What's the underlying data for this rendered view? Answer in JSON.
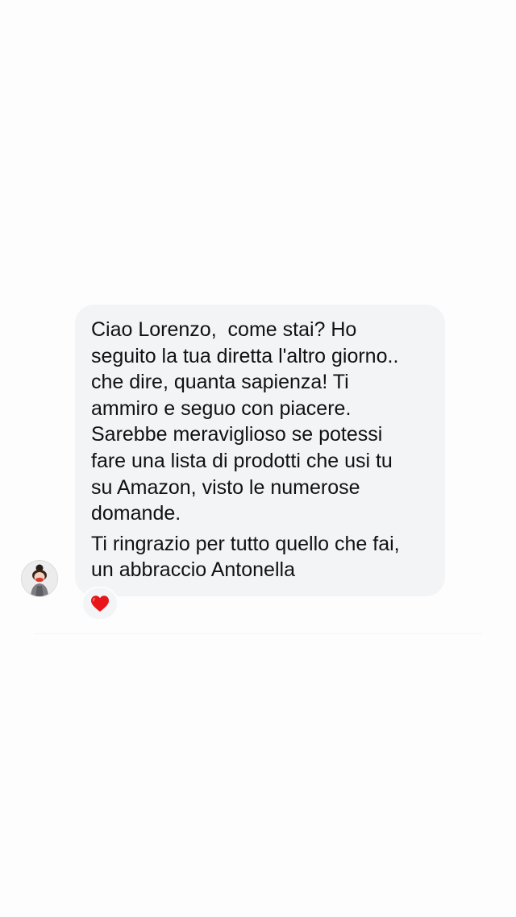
{
  "message": {
    "paragraphs": [
      {
        "lines": [
          "Ciao Lorenzo,  come stai? Ho",
          "seguito la tua diretta l'altro giorno..",
          "che dire, quanta sapienza! Ti",
          "ammiro e seguo con piacere.",
          "Sarebbe meraviglioso se potessi",
          "fare una lista di prodotti che usi tu",
          "su Amazon, visto le numerose",
          "domande."
        ]
      },
      {
        "lines": [
          "Ti ringrazio per tutto quello che fai,",
          "un abbraccio Antonella"
        ]
      }
    ],
    "bubble_color": "#f3f4f6",
    "text_color": "#111111"
  },
  "sender": {
    "avatar_icon": "avatar-icon"
  },
  "reaction": {
    "icon": "heart-icon",
    "color": "#e8161b"
  }
}
